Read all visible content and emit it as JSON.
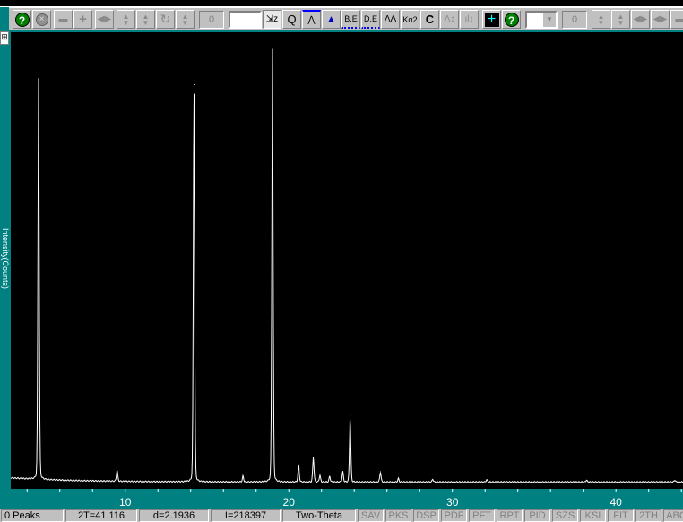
{
  "toolbar": {
    "left_buttons": [
      "help-icon",
      "stop-icon",
      "zoom-out-icon",
      "zoom-in-icon",
      "pan-horizontal-icon",
      "expand-vertical-icon",
      "scale-vertical-icon",
      "refresh-icon",
      "scroll-vertical-icon"
    ],
    "counter_value": "0",
    "text_input_value": "",
    "tools": [
      {
        "name": "select-zoom-icon",
        "label": "⇲z"
      },
      {
        "name": "magnify-icon",
        "label": "Q"
      },
      {
        "name": "peak-marker-icon",
        "label": "⋀"
      },
      {
        "name": "filled-peaks-icon",
        "label": "▲"
      },
      {
        "name": "background-edit-icon",
        "label": "B.E"
      },
      {
        "name": "data-edit-icon",
        "label": "D.E"
      },
      {
        "name": "peak-search-icon",
        "label": "ΛΛ"
      },
      {
        "name": "ka2-strip-icon",
        "label": "Kα2"
      },
      {
        "name": "calibrate-icon",
        "label": "C"
      },
      {
        "name": "peak-height-icon",
        "label": "Λ↕"
      },
      {
        "name": "bar-height-icon",
        "label": "ıl↕"
      },
      {
        "name": "crosshair-icon",
        "label": "+"
      },
      {
        "name": "help2-icon",
        "label": "?"
      }
    ],
    "dropdown_value": "",
    "counter2_value": "0",
    "right_buttons": [
      "scroll-up-down-icon",
      "scale-up-down-icon",
      "pan-left-right-icon",
      "shift-left-right-icon",
      "more-icon"
    ]
  },
  "plot": {
    "ylabel": "Intensity(Counts)"
  },
  "chart_data": {
    "type": "line",
    "xlabel": "Two-Theta",
    "ylabel": "Intensity(Counts)",
    "xlim": [
      3,
      44.1
    ],
    "ylim": [
      0,
      20000
    ],
    "xticks": [
      10,
      20,
      30,
      40
    ],
    "baseline": 300,
    "peaks": [
      {
        "x": 4.7,
        "y": 17600
      },
      {
        "x": 9.5,
        "y": 500
      },
      {
        "x": 14.2,
        "y": 17400
      },
      {
        "x": 17.2,
        "y": 250
      },
      {
        "x": 19.0,
        "y": 19000
      },
      {
        "x": 20.6,
        "y": 750
      },
      {
        "x": 21.5,
        "y": 1100
      },
      {
        "x": 21.9,
        "y": 300
      },
      {
        "x": 22.5,
        "y": 250
      },
      {
        "x": 23.3,
        "y": 450
      },
      {
        "x": 23.75,
        "y": 2900
      },
      {
        "x": 25.6,
        "y": 450
      },
      {
        "x": 26.7,
        "y": 150
      },
      {
        "x": 28.8,
        "y": 120
      },
      {
        "x": 32.1,
        "y": 100
      },
      {
        "x": 38.2,
        "y": 80
      },
      {
        "x": 43.6,
        "y": 80
      }
    ]
  },
  "status": {
    "peaks": "0 Peaks",
    "two_theta": "2T=41.116",
    "d": "d=2.1936",
    "intensity": "I=218397",
    "axis_mode": "Two-Theta",
    "buttons": [
      "SAV",
      "PKS",
      "DSP",
      "PDF",
      "PFT",
      "RPT",
      "PID",
      "SZS",
      "KSI",
      "FIT",
      "2TH",
      "ABC"
    ]
  }
}
